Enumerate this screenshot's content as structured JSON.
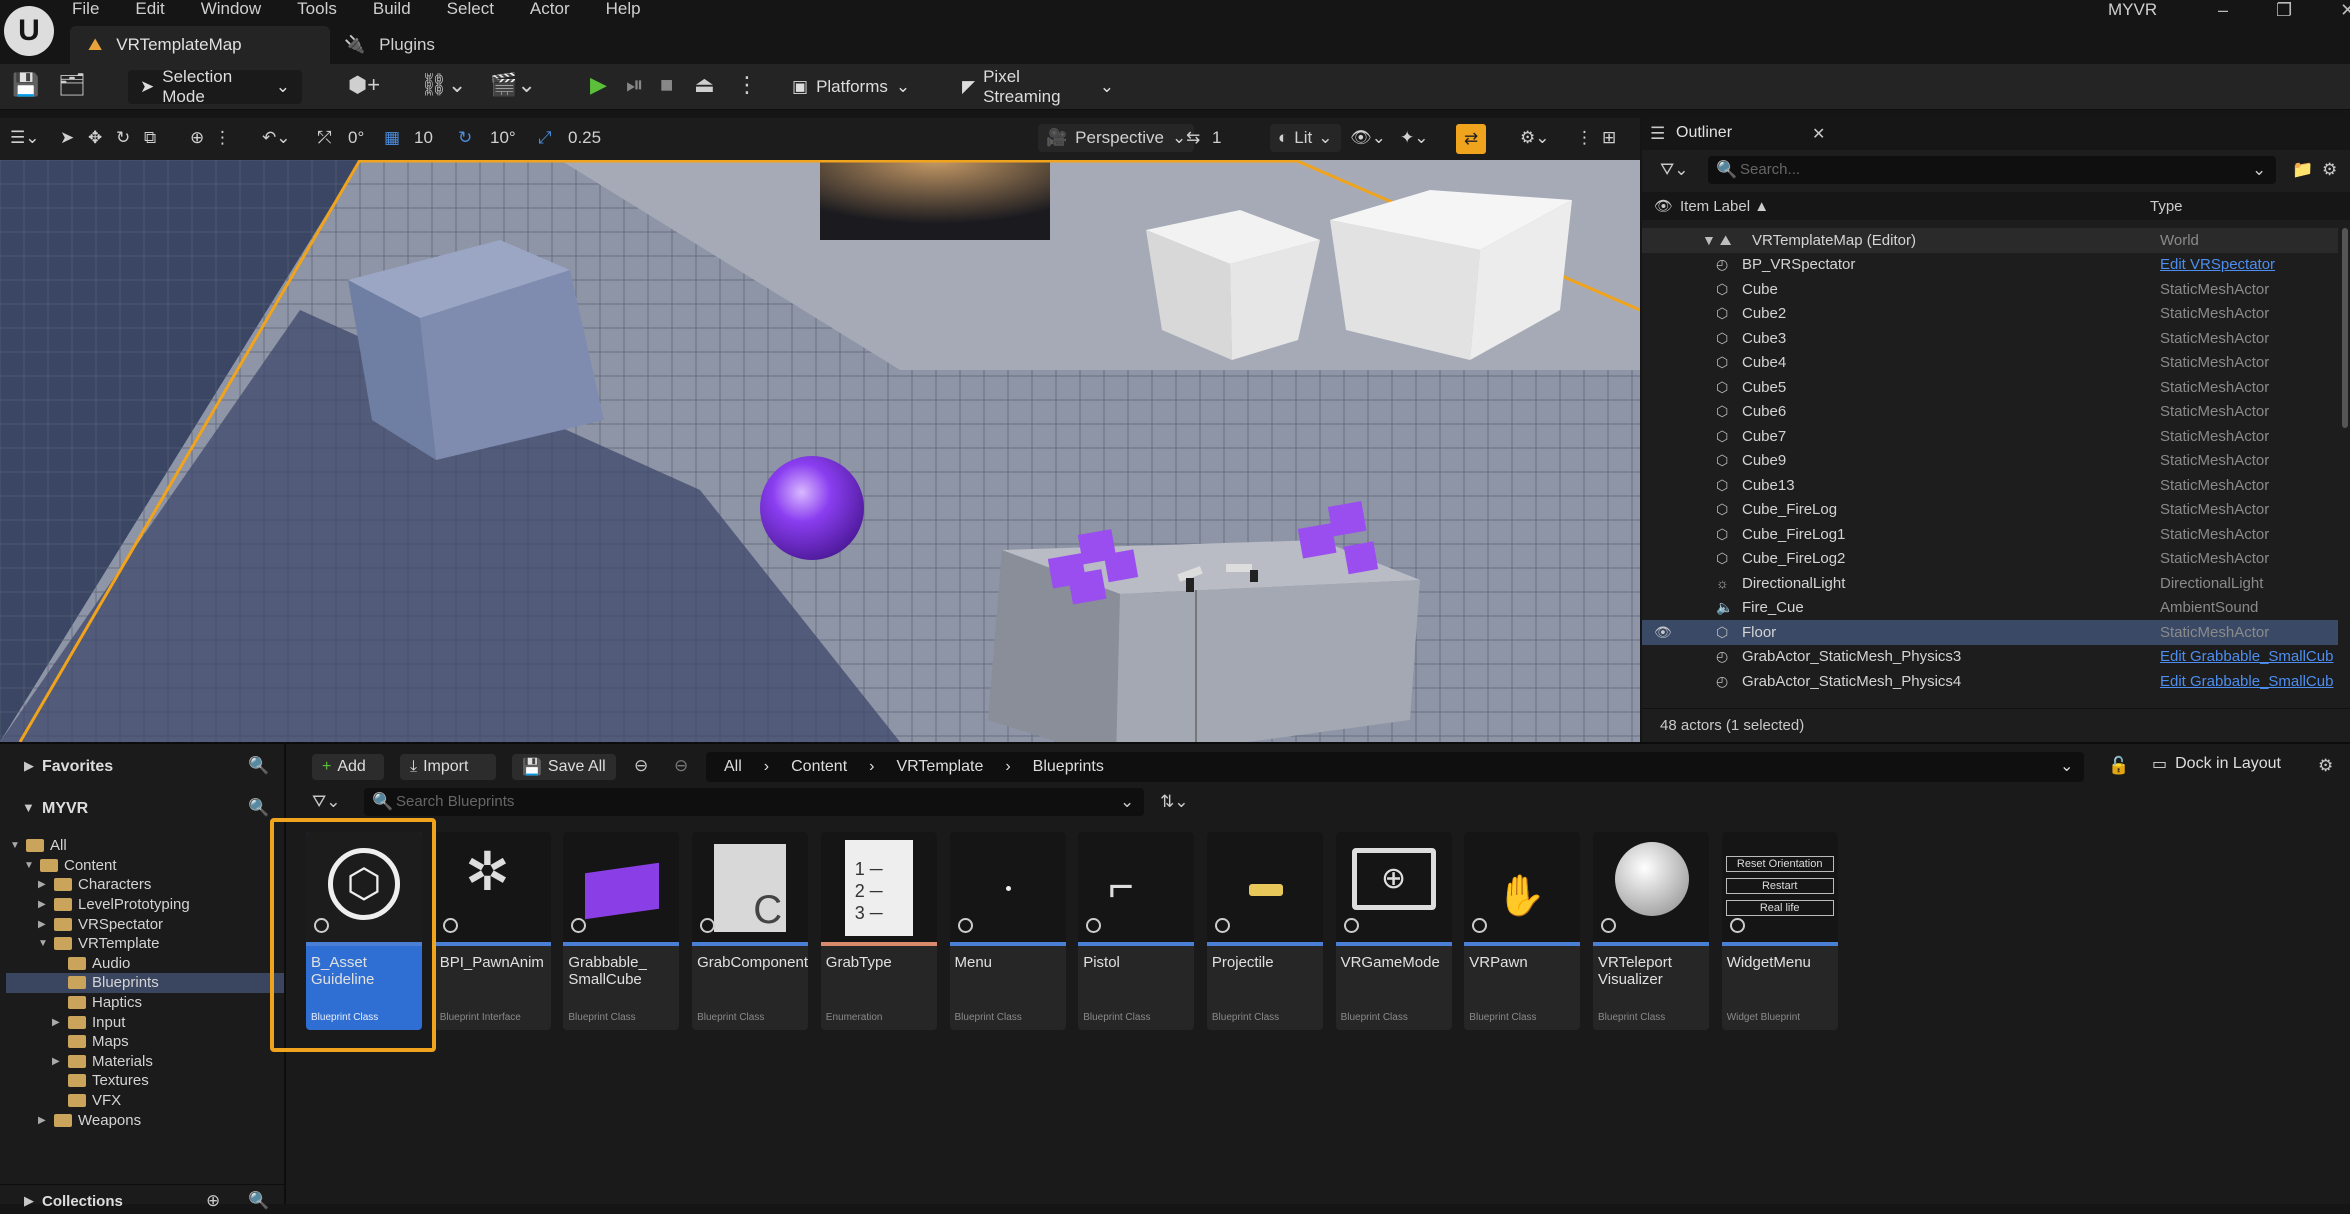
{
  "menubar": {
    "logo": "U",
    "items": [
      "File",
      "Edit",
      "Window",
      "Tools",
      "Build",
      "Select",
      "Actor",
      "Help"
    ],
    "project_name": "MYVR",
    "tabs": [
      {
        "label": "VRTemplateMap"
      },
      {
        "label": "Plugins"
      }
    ],
    "window_controls": [
      "–",
      "❐",
      "✕"
    ]
  },
  "toolbar": {
    "selection_mode": "Selection Mode",
    "platforms": "Platforms",
    "pixel_streaming": "Pixel Streaming"
  },
  "viewport_toolbar": {
    "rotate_snap_value": "0°",
    "grid_snap_value": "10",
    "angle_snap_value": "10°",
    "scale_snap_value": "0.25",
    "perspective": "Perspective",
    "camera_speed": "1",
    "lit": "Lit"
  },
  "outliner": {
    "title": "Outliner",
    "search_placeholder": "Search...",
    "col_label": "Item Label ▲",
    "col_type": "Type",
    "rows": [
      {
        "label": "VRTemplateMap (Editor)",
        "type": "World",
        "link": false
      },
      {
        "label": "BP_VRSpectator",
        "type": "Edit VRSpectator",
        "link": true
      },
      {
        "label": "Cube",
        "type": "StaticMeshActor",
        "link": false
      },
      {
        "label": "Cube2",
        "type": "StaticMeshActor",
        "link": false
      },
      {
        "label": "Cube3",
        "type": "StaticMeshActor",
        "link": false
      },
      {
        "label": "Cube4",
        "type": "StaticMeshActor",
        "link": false
      },
      {
        "label": "Cube5",
        "type": "StaticMeshActor",
        "link": false
      },
      {
        "label": "Cube6",
        "type": "StaticMeshActor",
        "link": false
      },
      {
        "label": "Cube7",
        "type": "StaticMeshActor",
        "link": false
      },
      {
        "label": "Cube9",
        "type": "StaticMeshActor",
        "link": false
      },
      {
        "label": "Cube13",
        "type": "StaticMeshActor",
        "link": false
      },
      {
        "label": "Cube_FireLog",
        "type": "StaticMeshActor",
        "link": false
      },
      {
        "label": "Cube_FireLog1",
        "type": "StaticMeshActor",
        "link": false
      },
      {
        "label": "Cube_FireLog2",
        "type": "StaticMeshActor",
        "link": false
      },
      {
        "label": "DirectionalLight",
        "type": "DirectionalLight",
        "link": false
      },
      {
        "label": "Fire_Cue",
        "type": "AmbientSound",
        "link": false
      },
      {
        "label": "Floor",
        "type": "StaticMeshActor",
        "link": false
      },
      {
        "label": "GrabActor_StaticMesh_Physics3",
        "type": "Edit Grabbable_SmallCub",
        "link": true
      },
      {
        "label": "GrabActor_StaticMesh_Physics4",
        "type": "Edit Grabbable_SmallCub",
        "link": true
      }
    ],
    "status": "48 actors (1 selected)"
  },
  "content_browser": {
    "favorites": "Favorites",
    "project": "MYVR",
    "add": "Add",
    "import": "Import",
    "save_all": "Save All",
    "path": [
      "All",
      "Content",
      "VRTemplate",
      "Blueprints"
    ],
    "dock": "Dock in Layout",
    "search_placeholder": "Search Blueprints",
    "collections": "Collections",
    "tree": [
      {
        "label": "All",
        "indent": 0,
        "arrow": "▼"
      },
      {
        "label": "Content",
        "indent": 1,
        "arrow": "▼"
      },
      {
        "label": "Characters",
        "indent": 2,
        "arrow": "▶"
      },
      {
        "label": "LevelPrototyping",
        "indent": 2,
        "arrow": "▶"
      },
      {
        "label": "VRSpectator",
        "indent": 2,
        "arrow": "▶"
      },
      {
        "label": "VRTemplate",
        "indent": 2,
        "arrow": "▼"
      },
      {
        "label": "Audio",
        "indent": 3,
        "arrow": ""
      },
      {
        "label": "Blueprints",
        "indent": 3,
        "arrow": ""
      },
      {
        "label": "Haptics",
        "indent": 3,
        "arrow": ""
      },
      {
        "label": "Input",
        "indent": 3,
        "arrow": "▶"
      },
      {
        "label": "Maps",
        "indent": 3,
        "arrow": ""
      },
      {
        "label": "Materials",
        "indent": 3,
        "arrow": "▶"
      },
      {
        "label": "Textures",
        "indent": 3,
        "arrow": ""
      },
      {
        "label": "VFX",
        "indent": 3,
        "arrow": ""
      },
      {
        "label": "Weapons",
        "indent": 2,
        "arrow": "▶"
      }
    ],
    "assets": [
      {
        "name": "B_Asset Guideline",
        "class": "Blueprint Class"
      },
      {
        "name": "BPI_PawnAnim",
        "class": "Blueprint Interface"
      },
      {
        "name": "Grabbable_ SmallCube",
        "class": "Blueprint Class"
      },
      {
        "name": "GrabComponent",
        "class": "Blueprint Class"
      },
      {
        "name": "GrabType",
        "class": "Enumeration"
      },
      {
        "name": "Menu",
        "class": "Blueprint Class"
      },
      {
        "name": "Pistol",
        "class": "Blueprint Class"
      },
      {
        "name": "Projectile",
        "class": "Blueprint Class"
      },
      {
        "name": "VRGameMode",
        "class": "Blueprint Class"
      },
      {
        "name": "VRPawn",
        "class": "Blueprint Class"
      },
      {
        "name": "VRTeleport Visualizer",
        "class": "Blueprint Class"
      },
      {
        "name": "WidgetMenu",
        "class": "Widget Blueprint"
      }
    ],
    "widget_menu_thumb": [
      "Reset Orientation",
      "Restart",
      "Real life"
    ]
  }
}
